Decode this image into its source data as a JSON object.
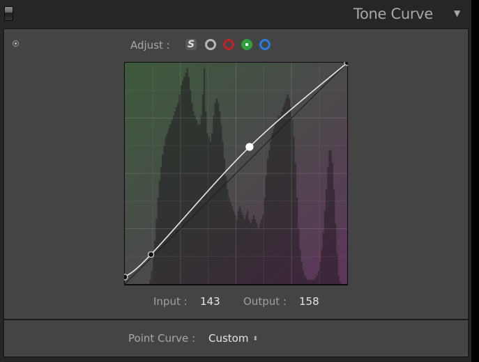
{
  "header": {
    "title": "Tone Curve",
    "collapse_icon": "▼"
  },
  "adjust": {
    "label": "Adjust :",
    "channels": [
      {
        "name": "parametric",
        "icon": "S",
        "selected": false
      },
      {
        "name": "rgb",
        "color": "#b8b8b8",
        "selected": false
      },
      {
        "name": "red",
        "color": "#c4222b",
        "selected": false
      },
      {
        "name": "green",
        "color": "#2f9e3e",
        "selected": true
      },
      {
        "name": "blue",
        "color": "#2a7ae0",
        "selected": false
      }
    ]
  },
  "curve": {
    "channel": "green",
    "range": [
      0,
      255
    ],
    "points": [
      {
        "input": 0,
        "output": 8,
        "selected": false
      },
      {
        "input": 30,
        "output": 34,
        "selected": false
      },
      {
        "input": 143,
        "output": 158,
        "selected": true
      },
      {
        "input": 255,
        "output": 255,
        "selected": false
      }
    ],
    "histogram": [
      0,
      0,
      0,
      0,
      0,
      0,
      0,
      0,
      0,
      0,
      0,
      0,
      0,
      0,
      0,
      0,
      2,
      6,
      12,
      20,
      30,
      40,
      48,
      54,
      60,
      64,
      68,
      70,
      72,
      74,
      76,
      78,
      80,
      82,
      84,
      88,
      92,
      94,
      96,
      98,
      100,
      96,
      90,
      84,
      80,
      78,
      76,
      74,
      74,
      78,
      88,
      100,
      80,
      70,
      68,
      66,
      70,
      78,
      84,
      86,
      84,
      80,
      74,
      66,
      58,
      50,
      44,
      40,
      38,
      36,
      34,
      32,
      30,
      34,
      36,
      34,
      32,
      30,
      32,
      34,
      30,
      28,
      30,
      32,
      30,
      28,
      26,
      28,
      30,
      32,
      40,
      50,
      58,
      62,
      66,
      70,
      72,
      74,
      76,
      78,
      78,
      80,
      82,
      84,
      86,
      88,
      86,
      82,
      76,
      68,
      56,
      40,
      26,
      16,
      10,
      6,
      4,
      3,
      2,
      2,
      2,
      2,
      2,
      3,
      4,
      6,
      10,
      16,
      24,
      34,
      44,
      54,
      62,
      62,
      56,
      44,
      28,
      14,
      4,
      1,
      0,
      0,
      0,
      0
    ]
  },
  "readout": {
    "input_label": "Input :",
    "input_value": "143",
    "output_label": "Output :",
    "output_value": "158"
  },
  "point_curve": {
    "label": "Point Curve :",
    "value": "Custom",
    "arrows": "⬍"
  }
}
